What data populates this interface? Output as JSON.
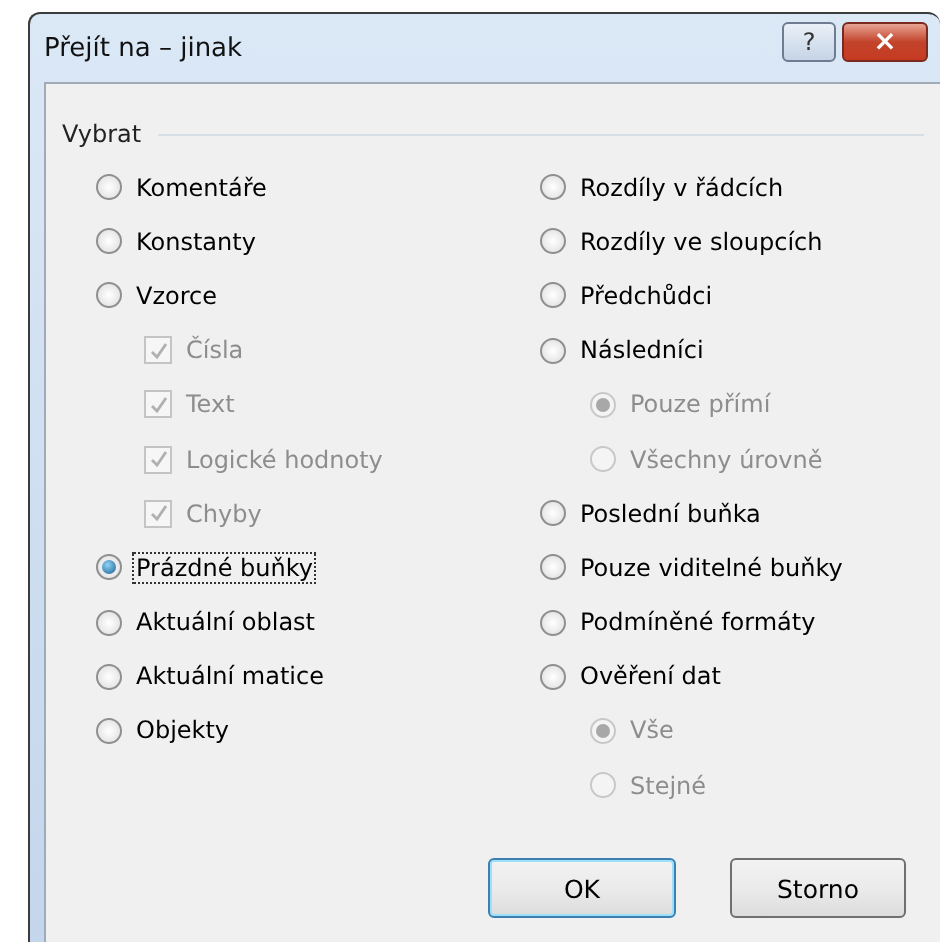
{
  "window": {
    "title": "Přejít na – jinak",
    "title_buttons": [
      {
        "kind": "help",
        "label": "?"
      },
      {
        "kind": "close",
        "label": "×"
      }
    ]
  },
  "group": {
    "label": "Vybrat",
    "columns": [
      [
        {
          "kind": "radio",
          "label": "Komentáře",
          "selected": false,
          "disabled": false,
          "focused": false
        },
        {
          "kind": "radio",
          "label": "Konstanty",
          "selected": false,
          "disabled": false,
          "focused": false
        },
        {
          "kind": "radio",
          "label": "Vzorce",
          "selected": false,
          "disabled": false,
          "focused": false,
          "children": [
            {
              "kind": "checkbox",
              "label": "Čísla",
              "checked": true,
              "disabled": true
            },
            {
              "kind": "checkbox",
              "label": "Text",
              "checked": true,
              "disabled": true
            },
            {
              "kind": "checkbox",
              "label": "Logické hodnoty",
              "checked": true,
              "disabled": true
            },
            {
              "kind": "checkbox",
              "label": "Chyby",
              "checked": true,
              "disabled": true
            }
          ]
        },
        {
          "kind": "radio",
          "label": "Prázdné buňky",
          "selected": true,
          "disabled": false,
          "focused": true
        },
        {
          "kind": "radio",
          "label": "Aktuální oblast",
          "selected": false,
          "disabled": false,
          "focused": false
        },
        {
          "kind": "radio",
          "label": "Aktuální matice",
          "selected": false,
          "disabled": false,
          "focused": false
        },
        {
          "kind": "radio",
          "label": "Objekty",
          "selected": false,
          "disabled": false,
          "focused": false
        }
      ],
      [
        {
          "kind": "radio",
          "label": "Rozdíly v řádcích",
          "selected": false,
          "disabled": false,
          "focused": false
        },
        {
          "kind": "radio",
          "label": "Rozdíly ve sloupcích",
          "selected": false,
          "disabled": false,
          "focused": false
        },
        {
          "kind": "radio",
          "label": "Předchůdci",
          "selected": false,
          "disabled": false,
          "focused": false
        },
        {
          "kind": "radio",
          "label": "Následníci",
          "selected": false,
          "disabled": false,
          "focused": false,
          "children": [
            {
              "kind": "radio",
              "label": "Pouze přímí",
              "selected": true,
              "disabled": true
            },
            {
              "kind": "radio",
              "label": "Všechny úrovně",
              "selected": false,
              "disabled": true
            }
          ]
        },
        {
          "kind": "radio",
          "label": "Poslední buňka",
          "selected": false,
          "disabled": false,
          "focused": false
        },
        {
          "kind": "radio",
          "label": "Pouze viditelné buňky",
          "selected": false,
          "disabled": false,
          "focused": false
        },
        {
          "kind": "radio",
          "label": "Podmíněné formáty",
          "selected": false,
          "disabled": false,
          "focused": false
        },
        {
          "kind": "radio",
          "label": "Ověření dat",
          "selected": false,
          "disabled": false,
          "focused": false,
          "children": [
            {
              "kind": "radio",
              "label": "Vše",
              "selected": true,
              "disabled": true
            },
            {
              "kind": "radio",
              "label": "Stejné",
              "selected": false,
              "disabled": true
            }
          ]
        }
      ]
    ]
  },
  "buttons": [
    {
      "label": "OK",
      "default": true
    },
    {
      "label": "Storno",
      "default": false
    }
  ]
}
